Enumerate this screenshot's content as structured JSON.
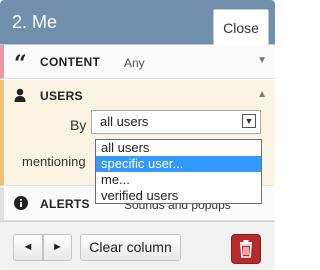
{
  "header": {
    "title": "2. Me",
    "close_label": "Close",
    "color": "#6f8fad"
  },
  "rows": {
    "content": {
      "icon": "quote-icon",
      "glyph": "“",
      "label": "CONTENT",
      "value": "Any",
      "arrow": "▼"
    },
    "users": {
      "icon": "user-icon",
      "label": "USERS",
      "arrow": "▲",
      "by_label": "By",
      "select_value": "all users",
      "mentioning_label": "mentioning"
    },
    "alerts": {
      "icon": "info-icon",
      "glyph": "i",
      "label": "ALERTS",
      "value": "Sounds and popups"
    }
  },
  "dropdown": {
    "options": [
      "all users",
      "specific user...",
      "me...",
      "verified users"
    ],
    "selected_index": 1
  },
  "footer": {
    "prev_glyph": "◄",
    "next_glyph": "►",
    "clear_label": "Clear column",
    "delete_icon": "trash-icon"
  }
}
